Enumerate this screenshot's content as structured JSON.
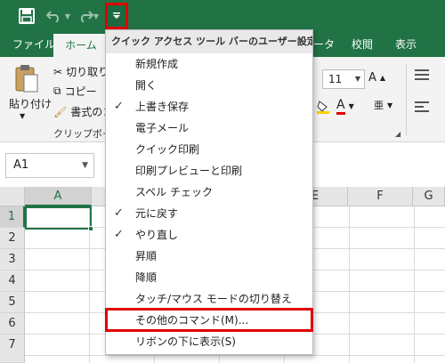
{
  "qat": {
    "save_icon": "save-icon",
    "undo_icon": "undo-icon",
    "redo_icon": "redo-icon",
    "customize_icon": "dropdown-caret-icon"
  },
  "tabs": {
    "file": "ファイル",
    "home": "ホーム",
    "data_partial": "ータ",
    "review": "校閲",
    "view": "表示"
  },
  "ribbon": {
    "paste_label": "貼り付け",
    "cut_label": "切り取り",
    "copy_label": "コピー",
    "format_painter_label": "書式のコ",
    "clipboard_group": "クリップボー",
    "font_size": "11"
  },
  "namebox": {
    "value": "A1"
  },
  "grid": {
    "columns": [
      "A",
      "E",
      "F",
      "G"
    ],
    "rows": [
      "1",
      "2",
      "3",
      "4",
      "5",
      "6",
      "7"
    ]
  },
  "menu": {
    "header": "クイック アクセス ツール バーのユーザー設定",
    "items": [
      {
        "label": "新規作成",
        "checked": false
      },
      {
        "label": "開く",
        "checked": false
      },
      {
        "label": "上書き保存",
        "checked": true
      },
      {
        "label": "電子メール",
        "checked": false
      },
      {
        "label": "クイック印刷",
        "checked": false
      },
      {
        "label": "印刷プレビューと印刷",
        "checked": false
      },
      {
        "label": "スペル チェック",
        "checked": false
      },
      {
        "label": "元に戻す",
        "checked": true
      },
      {
        "label": "やり直し",
        "checked": true
      },
      {
        "label": "昇順",
        "checked": false
      },
      {
        "label": "降順",
        "checked": false
      },
      {
        "label": "タッチ/マウス モードの切り替え",
        "checked": false
      },
      {
        "label": "その他のコマンド(M)...",
        "checked": false
      },
      {
        "label": "リボンの下に表示(S)",
        "checked": false
      }
    ],
    "check_glyph": "✓"
  },
  "colors": {
    "excel_green": "#217346",
    "highlight_red": "#e00000"
  }
}
